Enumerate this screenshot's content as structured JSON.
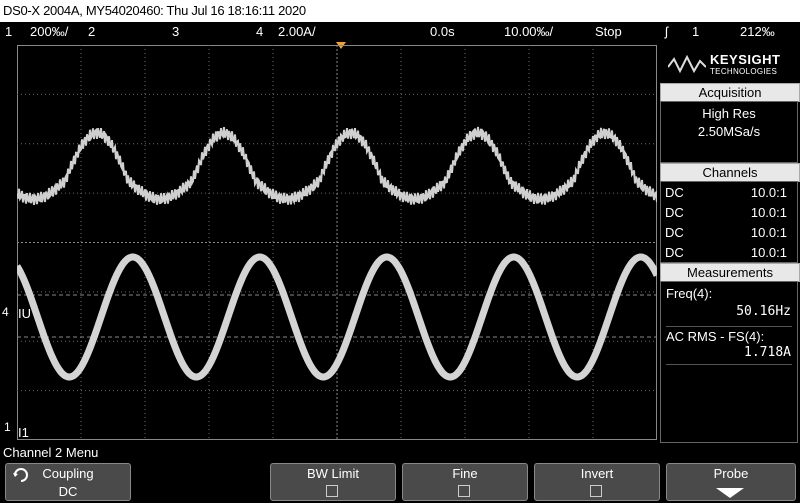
{
  "title": "DS0-X 2004A, MY54020460: Thu Jul 16 18:16:11 2020",
  "status": {
    "ch1_label": "1",
    "ch1_scale": "200‰/",
    "ch2_label": "2",
    "ch3_label": "3",
    "ch4_label": "4",
    "ch4_scale": "2.00A/",
    "time_delay": "0.0s",
    "time_scale": "10.00‰/",
    "run_state": "Stop",
    "trigger_symbol": "ʃ",
    "trigger_channel": "1",
    "trigger_level": "212‰"
  },
  "logo": {
    "line1": "KEYSIGHT",
    "line2": "TECHNOLOGIES"
  },
  "acquisition": {
    "header": "Acquisition",
    "mode": "High Res",
    "rate": "2.50MSa/s"
  },
  "channels": {
    "header": "Channels",
    "rows": [
      {
        "coupling": "DC",
        "probe": "10.0:1"
      },
      {
        "coupling": "DC",
        "probe": "10.0:1"
      },
      {
        "coupling": "DC",
        "probe": "10.0:1"
      },
      {
        "coupling": "DC",
        "probe": "10.0:1"
      }
    ]
  },
  "measurements": {
    "header": "Measurements",
    "freq_label": "Freq(4):",
    "freq_value": "50.16Hz",
    "rms_label": "AC RMS - FS(4):",
    "rms_value": "1.718A"
  },
  "markers": {
    "iu": "IU",
    "i1": "I1",
    "ch4": "4",
    "ch1": "1"
  },
  "menu_title": "Channel 2 Menu",
  "softkeys": {
    "coupling_label": "Coupling",
    "coupling_value": "DC",
    "bw_limit_label": "BW Limit",
    "fine_label": "Fine",
    "invert_label": "Invert",
    "probe_label": "Probe"
  },
  "colors": {
    "background": "#000000",
    "trace": "#cfcfcf",
    "trigger_marker": "#f2a22a",
    "grid": "#6a6a6a"
  }
}
